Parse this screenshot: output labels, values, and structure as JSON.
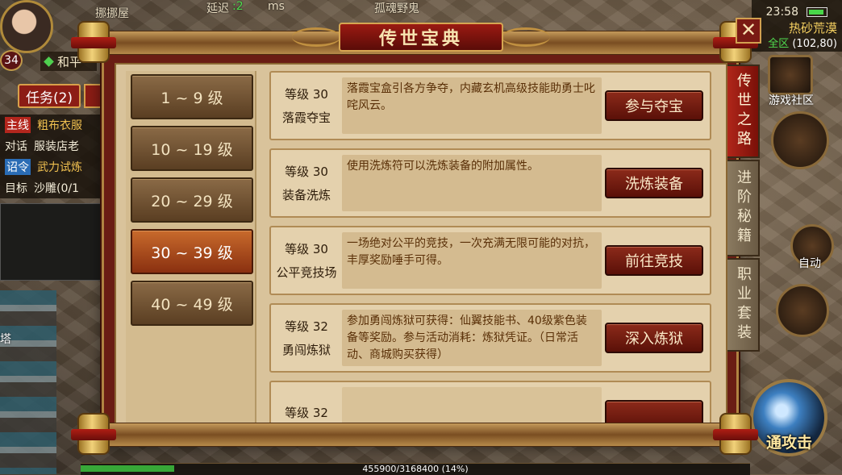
{
  "hud": {
    "level": "34",
    "pk_mode": "和平",
    "player_title": "挪挪屋",
    "latency_label": "延迟",
    "latency_value": ":2",
    "latency_unit": "ms",
    "target_name": "孤魂野鬼",
    "quest_tab": "任务(2)",
    "quests": [
      {
        "tag": "主线",
        "text": "粗布衣服"
      },
      {
        "tag": "对话",
        "text": "服装店老"
      },
      {
        "tag": "诏令",
        "text": "武力试炼"
      },
      {
        "tag": "目标",
        "text": "沙雕(0/1"
      }
    ],
    "pagoda_label": "塔",
    "time": "23:58",
    "zone_name": "热砂荒漠",
    "zone_scope": "全区",
    "zone_coord": "(102,80)",
    "community_label": "游戏社区",
    "auto_label": "自动",
    "attack_label": "通攻击",
    "exp_text": "455900/3168400 (14%)",
    "exp_fraction": 0.14
  },
  "dialog": {
    "title": "传世宝典",
    "levels": [
      {
        "label": "1 ~ 9 级",
        "active": false
      },
      {
        "label": "10 ~ 19 级",
        "active": false
      },
      {
        "label": "20 ~ 29 级",
        "active": false
      },
      {
        "label": "30 ~ 39 级",
        "active": true
      },
      {
        "label": "40 ~ 49 级",
        "active": false
      }
    ],
    "rows": [
      {
        "level": "等级 30",
        "name": "落霞夺宝",
        "desc": "落霞宝盒引各方争夺，内藏玄机高级技能助勇士叱咤风云。",
        "button": "参与夺宝"
      },
      {
        "level": "等级 30",
        "name": "装备洗炼",
        "desc": "使用洗炼符可以洗炼装备的附加属性。",
        "button": "洗炼装备"
      },
      {
        "level": "等级 30",
        "name": "公平竞技场",
        "desc": "一场绝对公平的竞技，一次充满无限可能的对抗，丰厚奖励唾手可得。",
        "button": "前往竞技"
      },
      {
        "level": "等级 32",
        "name": "勇闯炼狱",
        "desc": "参加勇闯炼狱可获得：仙翼技能书、40级紫色装备等奖励。参与活动消耗：炼狱凭证。（日常活动、商城购买获得）",
        "button": "深入炼狱"
      },
      {
        "level": "等级 32",
        "name": "",
        "desc": "",
        "button": ""
      }
    ],
    "side_tabs": [
      {
        "label": "传世之路",
        "active": true
      },
      {
        "label": "进阶秘籍",
        "active": false
      },
      {
        "label": "职业套装",
        "active": false
      }
    ],
    "close_symbol": "✕"
  },
  "colors": {
    "frame_red": "#6a1d14",
    "parchment": "#d9c39b",
    "button_red": "#8c2a1a",
    "active_level": "#c86a2c",
    "gold_trim": "#b08442"
  }
}
